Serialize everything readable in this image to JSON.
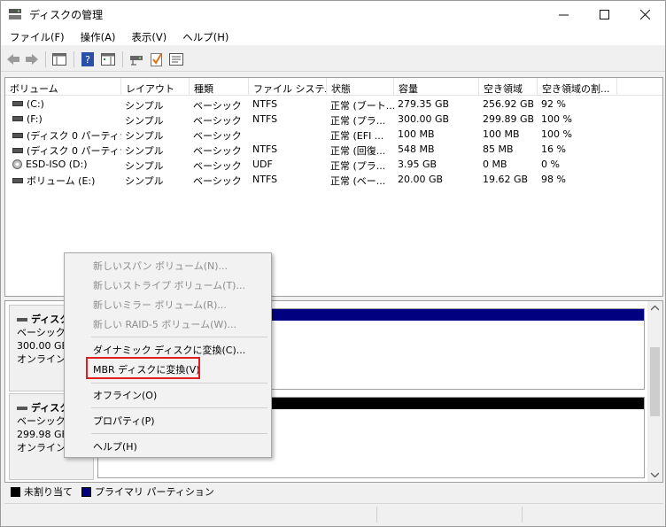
{
  "window": {
    "title": "ディスクの管理",
    "minimize": "—",
    "maximize": "☐",
    "close": "✕"
  },
  "menubar": [
    "ファイル(F)",
    "操作(A)",
    "表示(V)",
    "ヘルプ(H)"
  ],
  "toolbar_icons": [
    "back-arrow-icon",
    "forward-arrow-icon",
    "console-tree-icon",
    "help-icon",
    "action-pane-icon",
    "connect-disk-icon",
    "check-icon",
    "properties-icon"
  ],
  "volumes": {
    "columns": [
      "ボリューム",
      "レイアウト",
      "種類",
      "ファイル システム",
      "状態",
      "容量",
      "空き領域",
      "空き領域の割..."
    ],
    "rows": [
      {
        "icon": "drive",
        "name": "(C:)",
        "layout": "シンプル",
        "type": "ベーシック",
        "fs": "NTFS",
        "status": "正常 (ブート...",
        "capacity": "279.35 GB",
        "free": "256.92 GB",
        "pct": "92 %"
      },
      {
        "icon": "drive",
        "name": "(F:)",
        "layout": "シンプル",
        "type": "ベーシック",
        "fs": "NTFS",
        "status": "正常 (プラ...",
        "capacity": "300.00 GB",
        "free": "299.89 GB",
        "pct": "100 %"
      },
      {
        "icon": "drive",
        "name": "(ディスク 0 パーティシ...",
        "layout": "シンプル",
        "type": "ベーシック",
        "fs": "",
        "status": "正常 (EFI ...",
        "capacity": "100 MB",
        "free": "100 MB",
        "pct": "100 %"
      },
      {
        "icon": "drive",
        "name": "(ディスク 0 パーティシ...",
        "layout": "シンプル",
        "type": "ベーシック",
        "fs": "NTFS",
        "status": "正常 (回復...",
        "capacity": "548 MB",
        "free": "85 MB",
        "pct": "16 %"
      },
      {
        "icon": "disc",
        "name": "ESD-ISO (D:)",
        "layout": "シンプル",
        "type": "ベーシック",
        "fs": "UDF",
        "status": "正常 (プラ...",
        "capacity": "3.95 GB",
        "free": "0 MB",
        "pct": "0 %"
      },
      {
        "icon": "drive",
        "name": "ボリューム (E:)",
        "layout": "シンプル",
        "type": "ベーシック",
        "fs": "NTFS",
        "status": "正常 (ベー...",
        "capacity": "20.00 GB",
        "free": "19.62 GB",
        "pct": "98 %"
      }
    ]
  },
  "disks": [
    {
      "title": "ディスク",
      "type": "ベーシック",
      "size": "300.00 GB",
      "state": "オンライン",
      "bar_color": "#000080"
    },
    {
      "title": "ディスク",
      "type": "ベーシック",
      "size": "299.98 GB",
      "state": "オンライン",
      "bar_color": "#000000"
    }
  ],
  "legend": [
    {
      "label": "未割り当て",
      "color": "#000000"
    },
    {
      "label": "プライマリ パーティション",
      "color": "#000080"
    }
  ],
  "context_menu": {
    "items": [
      {
        "label": "新しいスパン ボリューム(N)...",
        "enabled": false
      },
      {
        "label": "新しいストライプ ボリューム(T)...",
        "enabled": false
      },
      {
        "label": "新しいミラー ボリューム(R)...",
        "enabled": false
      },
      {
        "label": "新しい RAID-5 ボリューム(W)...",
        "enabled": false
      },
      {
        "label": "ダイナミック ディスクに変換(C)...",
        "enabled": true
      },
      {
        "label": "MBR ディスクに変換(V)",
        "enabled": true,
        "highlighted": true
      },
      {
        "label": "オフライン(O)",
        "enabled": true
      },
      {
        "label": "プロパティ(P)",
        "enabled": true
      },
      {
        "label": "ヘルプ(H)",
        "enabled": true
      }
    ],
    "highlight_color": "#e02020"
  }
}
